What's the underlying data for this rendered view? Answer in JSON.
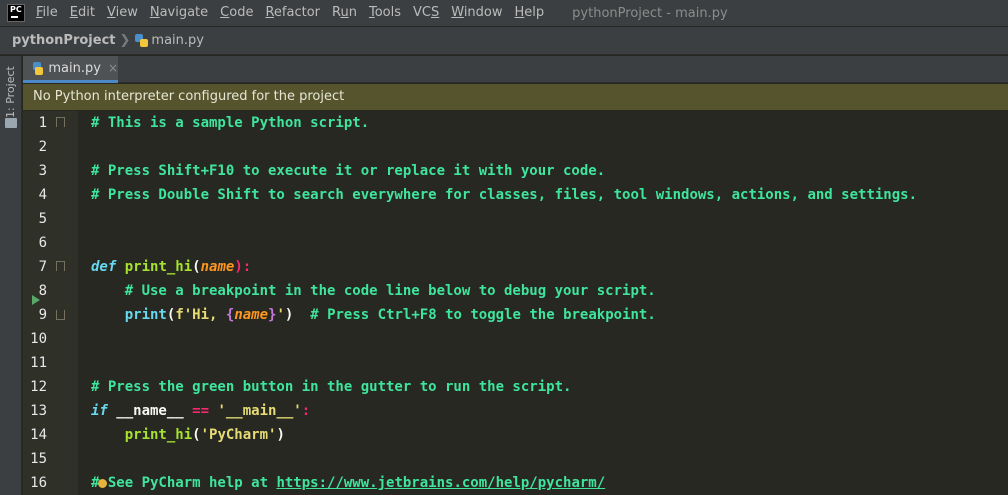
{
  "app_logo_text": "PC",
  "menu": [
    {
      "pre": "",
      "u": "F",
      "post": "ile"
    },
    {
      "pre": "",
      "u": "E",
      "post": "dit"
    },
    {
      "pre": "",
      "u": "V",
      "post": "iew"
    },
    {
      "pre": "",
      "u": "N",
      "post": "avigate"
    },
    {
      "pre": "",
      "u": "C",
      "post": "ode"
    },
    {
      "pre": "",
      "u": "R",
      "post": "efactor"
    },
    {
      "pre": "R",
      "u": "u",
      "post": "n"
    },
    {
      "pre": "",
      "u": "T",
      "post": "ools"
    },
    {
      "pre": "VC",
      "u": "S",
      "post": ""
    },
    {
      "pre": "",
      "u": "W",
      "post": "indow"
    },
    {
      "pre": "",
      "u": "H",
      "post": "elp"
    }
  ],
  "window_title": "pythonProject - main.py",
  "breadcrumb": {
    "project": "pythonProject",
    "separator": "❯",
    "file": "main.py"
  },
  "tool_window_label": "1: Project",
  "tab": {
    "label": "main.py",
    "close": "×"
  },
  "banner": "No Python interpreter configured for the project",
  "line_numbers": [
    "1",
    "2",
    "3",
    "4",
    "5",
    "6",
    "7",
    "8",
    "9",
    "10",
    "11",
    "12",
    "13",
    "14",
    "15",
    "16"
  ],
  "code": {
    "l1": "# This is a sample Python script.",
    "l3": "# Press Shift+F10 to execute it or replace it with your code.",
    "l4": "# Press Double Shift to search everywhere for classes, files, tool windows, actions, and settings.",
    "l7": {
      "kw": "def",
      "fn": "print_hi",
      "p1": "(",
      "param": "name",
      "p2": "):"
    },
    "l8": "    # Use a breakpoint in the code line below to debug your script.",
    "l9": {
      "indent": "    ",
      "bi": "print",
      "p1": "(",
      "s1": "f'Hi, ",
      "b1": "{",
      "v": "name",
      "b2": "}",
      "s2": "'",
      "p2": ")",
      "cm": "  # Press Ctrl+F8 to toggle the breakpoint."
    },
    "l12": "# Press the green button in the gutter to run the script.",
    "l13": {
      "kw": "if",
      "a": " __name__ ",
      "op": "==",
      "sp": " ",
      "st": "'__main__'",
      "col": ":"
    },
    "l14": {
      "indent": "    ",
      "fn": "print_hi",
      "p1": "(",
      "st": "'PyCharm'",
      "p2": ")"
    },
    "l16": {
      "pre": "# See PyCharm help at ",
      "url": "https://www.jetbrains.com/help/pycharm/"
    }
  },
  "colors": {
    "comment": "#3fe59d",
    "keyword": "#66d9ef",
    "function": "#a6e22e",
    "parameter": "#fd971f",
    "string": "#e6db74",
    "operator": "#f92672",
    "background": "#272822",
    "banner": "#55542d",
    "run_icon": "#59a869"
  }
}
